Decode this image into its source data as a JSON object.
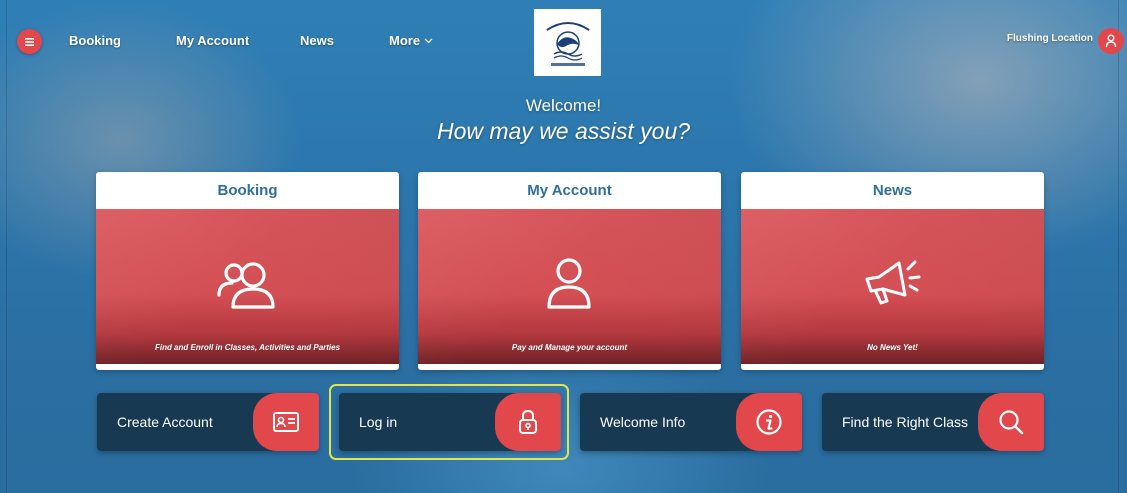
{
  "colors": {
    "accent_red": "#e2474c",
    "dark_navy": "#173a52",
    "title_blue": "#2e6fa0",
    "highlight": "#dfe64a"
  },
  "nav": {
    "menu_icon": "hamburger-icon",
    "links": [
      "Booking",
      "My Account",
      "News",
      "More"
    ],
    "more_icon": "chevron-down-icon",
    "logo_icon": "dolphin-swimming-logo",
    "location": "Flushing Location",
    "user_icon": "user-icon"
  },
  "welcome": {
    "line1": "Welcome!",
    "line2": "How may we assist you?"
  },
  "cards": [
    {
      "title": "Booking",
      "caption": "Find and Enroll in Classes, Activities and Parties",
      "icon": "users-icon"
    },
    {
      "title": "My Account",
      "caption": "Pay and Manage your account",
      "icon": "user-icon"
    },
    {
      "title": "News",
      "caption": "No News Yet!",
      "icon": "megaphone-icon"
    }
  ],
  "actions": [
    {
      "label": "Create Account",
      "icon": "id-card-icon"
    },
    {
      "label": "Log in",
      "icon": "lock-icon"
    },
    {
      "label": "Welcome Info",
      "icon": "info-icon"
    },
    {
      "label": "Find the Right Class",
      "icon": "search-icon"
    }
  ]
}
